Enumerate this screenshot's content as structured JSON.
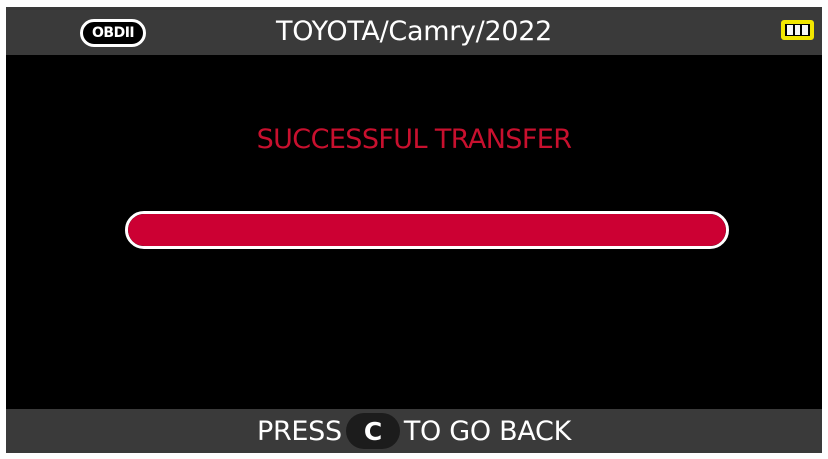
{
  "header": {
    "badge": "OBDII",
    "title": "TOYOTA/Camry/2022",
    "battery_icon": "battery-full-icon"
  },
  "main": {
    "status": "SUCCESSFUL TRANSFER",
    "progress_fraction": 1.0
  },
  "footer": {
    "press_label": "PRESS",
    "key_label": "C",
    "action_label": "TO GO BACK"
  },
  "colors": {
    "accent_red": "#cc0033",
    "status_red": "#c8102e",
    "bar_gray": "#3a3a3a",
    "battery_yellow": "#f2e600"
  }
}
